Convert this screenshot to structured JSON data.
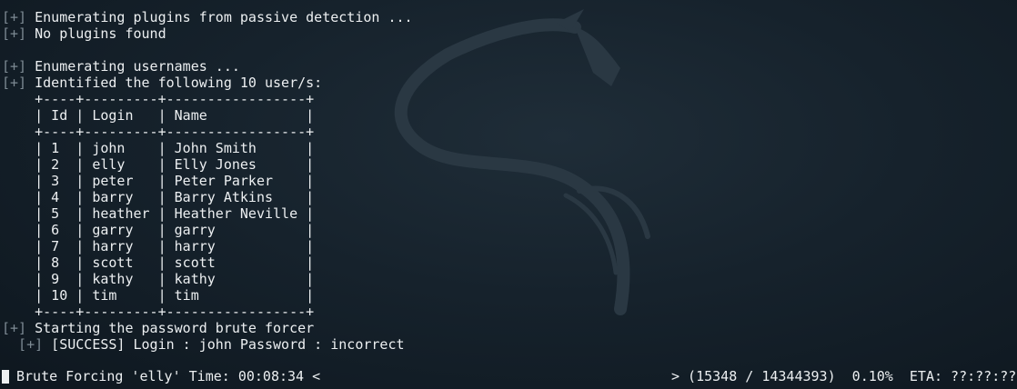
{
  "terminal": {
    "lines": [
      {
        "prefix": "[+]",
        "text": " Enumerating plugins from passive detection ..."
      },
      {
        "prefix": "[+]",
        "text": " No plugins found"
      },
      {
        "prefix": "",
        "text": ""
      },
      {
        "prefix": "[+]",
        "text": " Enumerating usernames ..."
      },
      {
        "prefix": "[+]",
        "text": " Identified the following 10 user/s:"
      },
      {
        "prefix": "",
        "text": "    +----+---------+-----------------+"
      },
      {
        "prefix": "",
        "text": "    | Id | Login   | Name            |"
      },
      {
        "prefix": "",
        "text": "    +----+---------+-----------------+"
      },
      {
        "prefix": "",
        "text": "    | 1  | john    | John Smith      |"
      },
      {
        "prefix": "",
        "text": "    | 2  | elly    | Elly Jones      |"
      },
      {
        "prefix": "",
        "text": "    | 3  | peter   | Peter Parker    |"
      },
      {
        "prefix": "",
        "text": "    | 4  | barry   | Barry Atkins    |"
      },
      {
        "prefix": "",
        "text": "    | 5  | heather | Heather Neville |"
      },
      {
        "prefix": "",
        "text": "    | 6  | garry   | garry           |"
      },
      {
        "prefix": "",
        "text": "    | 7  | harry   | harry           |"
      },
      {
        "prefix": "",
        "text": "    | 8  | scott   | scott           |"
      },
      {
        "prefix": "",
        "text": "    | 9  | kathy   | kathy           |"
      },
      {
        "prefix": "",
        "text": "    | 10 | tim     | tim             |"
      },
      {
        "prefix": "",
        "text": "    +----+---------+-----------------+"
      },
      {
        "prefix": "[+]",
        "text": " Starting the password brute forcer"
      },
      {
        "prefix": "  [+]",
        "text": " [SUCCESS] Login : john Password : incorrect"
      }
    ]
  },
  "status_bar": {
    "left": "Brute Forcing 'elly' Time: 00:08:34 <",
    "right": "> (15348 / 14344393)  0.10%  ETA: ??:??:??"
  },
  "icons": {
    "background": "kali-dragon-icon",
    "cursor": "cursor-block"
  }
}
